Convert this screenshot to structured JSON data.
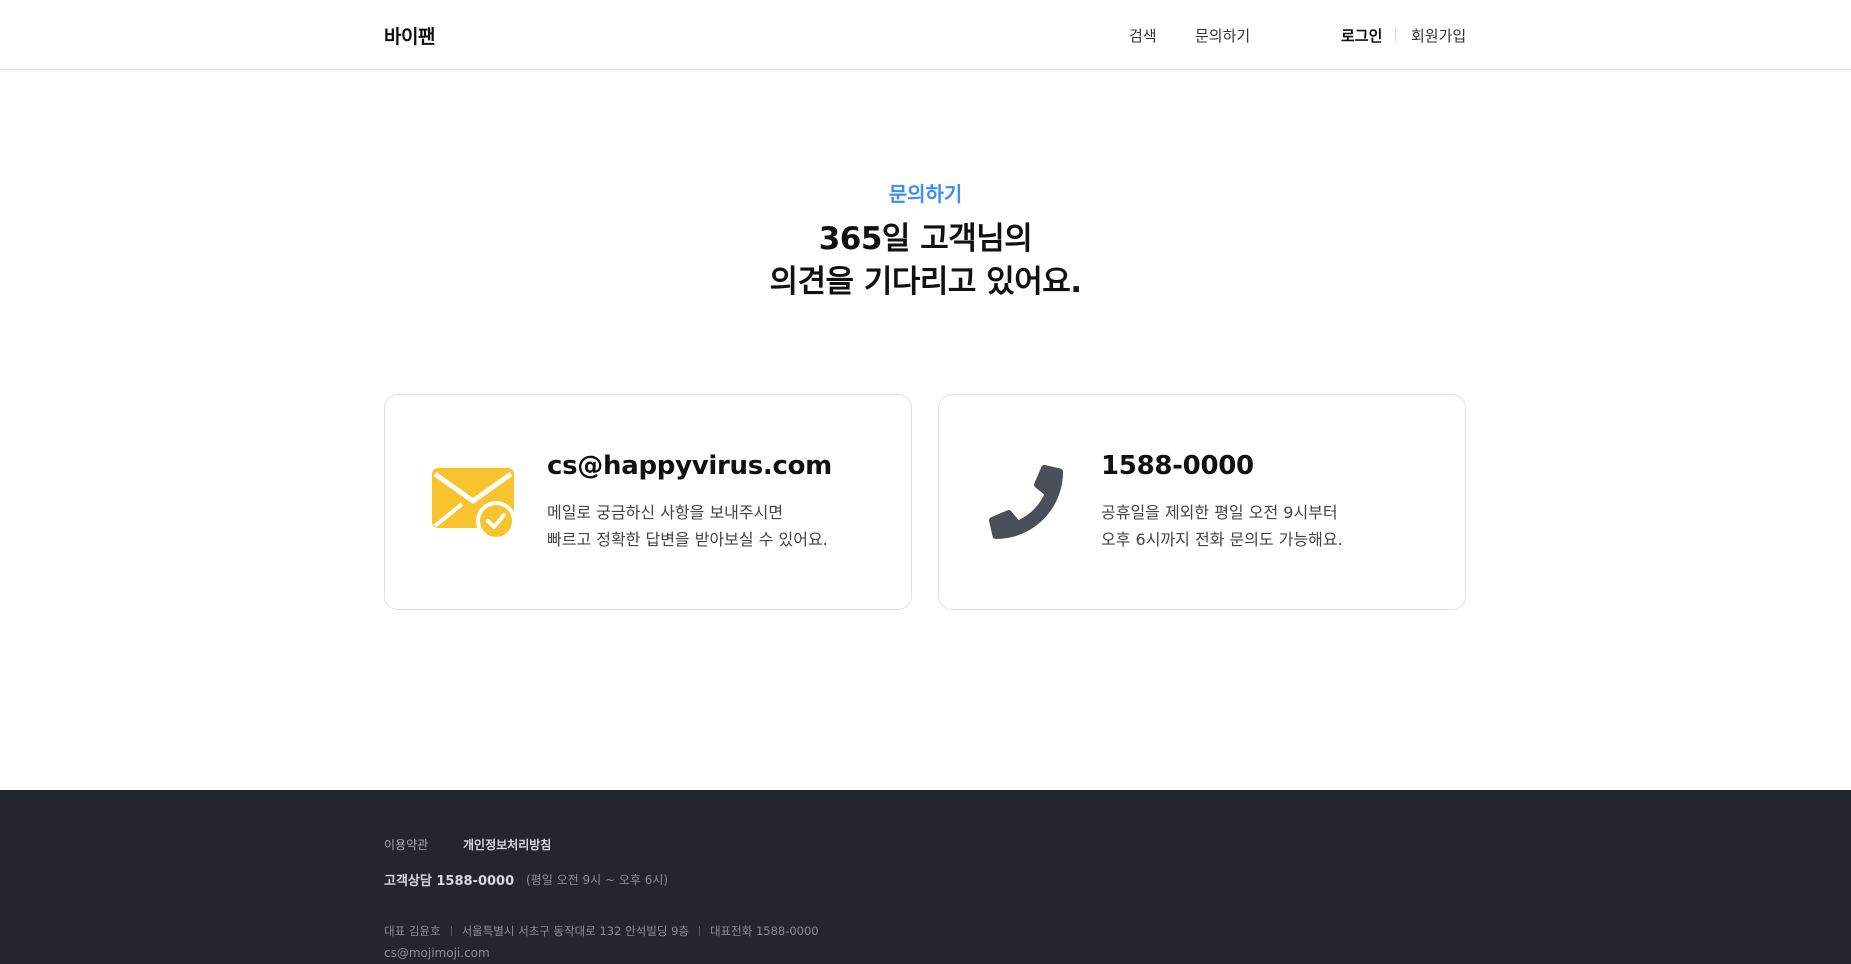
{
  "header": {
    "logo": "바이팬",
    "nav": {
      "search": "검색",
      "inquiry": "문의하기",
      "login": "로그인",
      "signup": "회원가입"
    }
  },
  "hero": {
    "label": "문의하기",
    "title_line1": "365일 고객님의",
    "title_line2": "의견을 기다리고 있어요."
  },
  "cards": {
    "email": {
      "icon": "mail-check-icon",
      "title": "cs@happyvirus.com",
      "desc_line1": "메일로 궁금하신 사항을 보내주시면",
      "desc_line2": "빠르고 정확한 답변을 받아보실 수 있어요."
    },
    "phone": {
      "icon": "phone-icon",
      "title": "1588-0000",
      "desc_line1": "공휴일을 제외한 평일 오전 9시부터",
      "desc_line2": "오후 6시까지 전화 문의도 가능해요."
    }
  },
  "footer": {
    "terms": "이용약관",
    "privacy": "개인정보처리방침",
    "cs": "고객상담 1588-0000",
    "hours": "(평일 오전 9시 ~ 오후 6시)",
    "ceo": "대표 김윤호",
    "address": "서울특별시 서초구 동작대로 132 안석빌딩 9층",
    "tel": "대표전화 1588-0000",
    "email": "cs@mojimoji.com"
  },
  "colors": {
    "accent": "#3b8ff0",
    "mail_icon": "#f8c42e",
    "phone_icon": "#4b4f58",
    "footer_bg": "#24262e"
  }
}
